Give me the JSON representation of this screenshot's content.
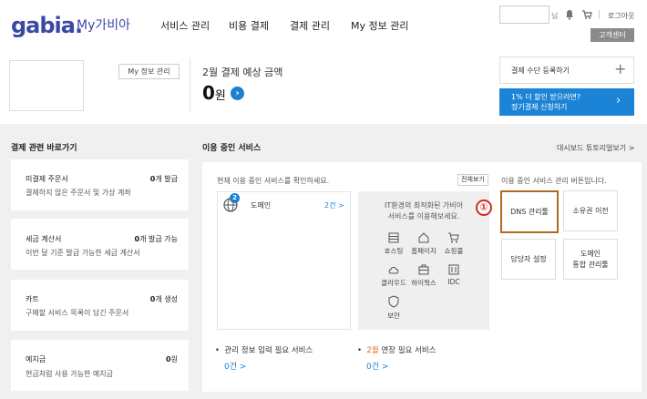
{
  "header": {
    "logo": "gabia.",
    "logo_sub": "My가비아",
    "nav": [
      "서비스 관리",
      "비용 결제",
      "결제 관리",
      "My 정보 관리"
    ],
    "user_suffix": "님",
    "logout": "로그아웃",
    "support": "고객센터"
  },
  "summary": {
    "myinfo_button": "My 정보 관리",
    "payment_label": "2월 결제 예상 금액",
    "payment_amount": "0",
    "payment_unit": "원",
    "register_label": "결제 수단 등록하기",
    "register_icon": "plus-icon",
    "promo_line1": "1% 더 할인 받으려면?",
    "promo_line2": "정기결제 신청하기"
  },
  "shortcuts": {
    "title": "결제 관련 바로가기",
    "cards": [
      {
        "title": "미결제 주문서",
        "count": "0",
        "unit": "개 발급",
        "desc": "결제하지 않은 주문서 및 가상 계좌"
      },
      {
        "title": "세금 계산서",
        "count": "0",
        "unit": "개 발급 가능",
        "desc": "이번 달 기준 발급 가능한 세금 계산서"
      },
      {
        "title": "카트",
        "count": "0",
        "unit": "개 생성",
        "desc": "구매할 서비스 목록이 담긴 주문서"
      },
      {
        "title": "예치금",
        "count": "0",
        "unit": "원",
        "desc": "현금처럼 사용 가능한 예치금"
      }
    ]
  },
  "services": {
    "title": "이용 중인 서비스",
    "dashboard_link": "대시보드 튜토리얼보기 >",
    "desc": "현재 이용 중인 서비스를 확인하세요.",
    "all_button": "전체보기",
    "badge": "2",
    "domain_label": "도메인",
    "domain_count": "2건 >",
    "rec_text1": "IT환경의 최적화된 가비아",
    "rec_text2": "서비스를 이용해보세요.",
    "rec_items": [
      {
        "label": "호스팅",
        "icon": "hosting-icon"
      },
      {
        "label": "홈페이지",
        "icon": "home-icon"
      },
      {
        "label": "쇼핑몰",
        "icon": "cart-icon"
      },
      {
        "label": "클라우드",
        "icon": "cloud-icon"
      },
      {
        "label": "하이웍스",
        "icon": "briefcase-icon"
      },
      {
        "label": "IDC",
        "icon": "server-icon"
      },
      {
        "label": "보안",
        "icon": "shield-icon"
      }
    ],
    "hint": "이용 중인 서비스 관리 버튼입니다.",
    "tiles": [
      "DNS 관리툴",
      "소유권 이전",
      "담당자 설정",
      "도메인\n통합 관리툴"
    ],
    "marker": "①",
    "bullets": [
      {
        "text": "관리 정보 입력 필요 서비스",
        "count": "0건 >"
      },
      {
        "prefix": "2월",
        "text": " 연장 필요 서비스",
        "count": "0건 >"
      }
    ]
  },
  "colors": {
    "brand": "#3a4aa3",
    "accent": "#1c84d6",
    "highlight": "#b06a1c",
    "marker": "#d12b1f"
  }
}
